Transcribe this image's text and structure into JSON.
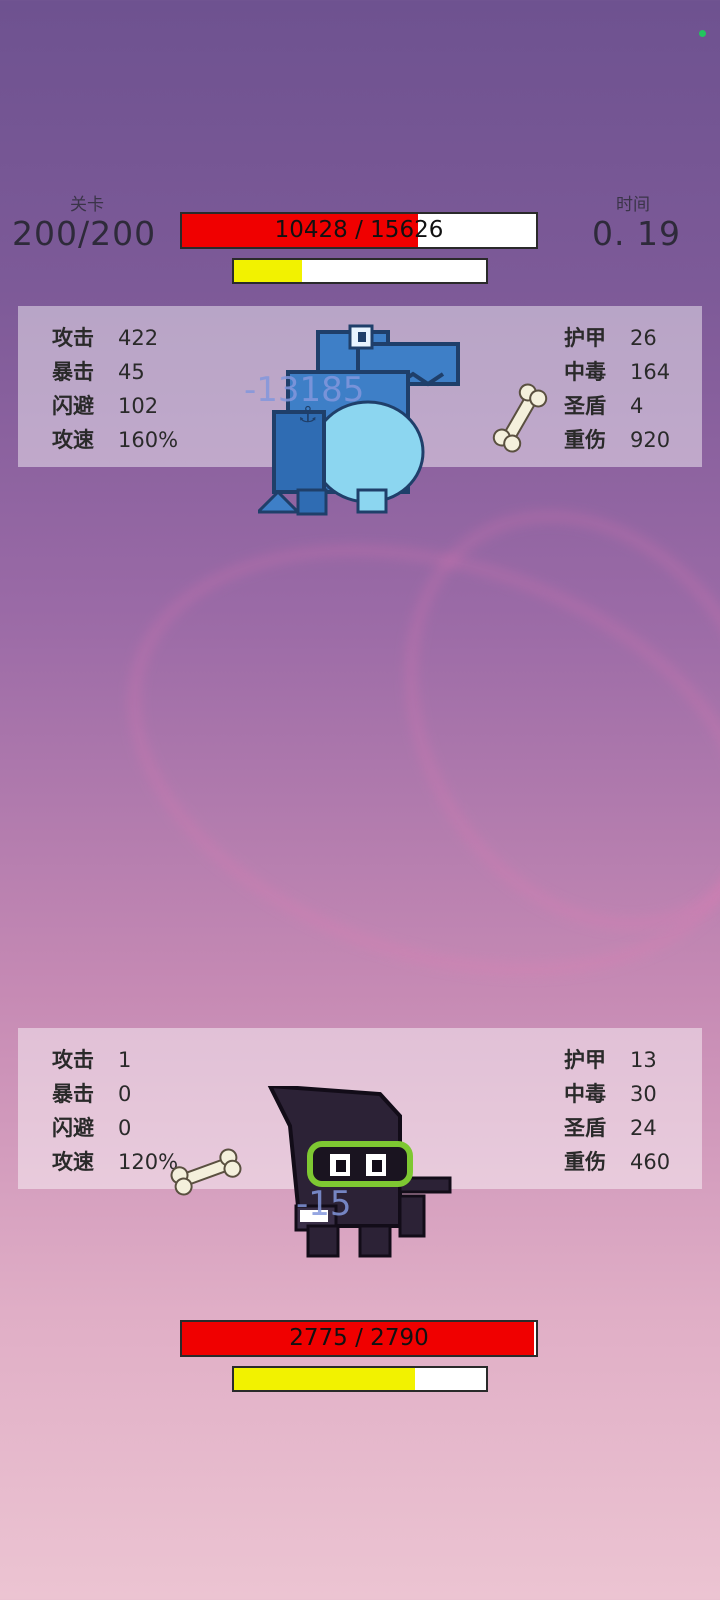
{
  "header": {
    "level_label": "关卡",
    "level_value": "200/200",
    "time_label": "时间",
    "time_value": "0. 19"
  },
  "enemy": {
    "hp_text": "10428 / 15626",
    "hp_fraction": 0.667,
    "energy_fraction": 0.27,
    "damage_text": "-13185",
    "stats_left": [
      {
        "label": "攻击",
        "value": "422"
      },
      {
        "label": "暴击",
        "value": "45"
      },
      {
        "label": "闪避",
        "value": "102"
      },
      {
        "label": "攻速",
        "value": "160%"
      }
    ],
    "stats_right": [
      {
        "label": "护甲",
        "value": "26"
      },
      {
        "label": "中毒",
        "value": "164"
      },
      {
        "label": "圣盾",
        "value": "4"
      },
      {
        "label": "重伤",
        "value": "920"
      }
    ]
  },
  "player": {
    "hp_text": "2775 / 2790",
    "hp_fraction": 0.995,
    "energy_fraction": 0.72,
    "damage_text": "-15",
    "stats_left": [
      {
        "label": "攻击",
        "value": "1"
      },
      {
        "label": "暴击",
        "value": "0"
      },
      {
        "label": "闪避",
        "value": "0"
      },
      {
        "label": "攻速",
        "value": "120%"
      }
    ],
    "stats_right": [
      {
        "label": "护甲",
        "value": "13"
      },
      {
        "label": "中毒",
        "value": "30"
      },
      {
        "label": "圣盾",
        "value": "24"
      },
      {
        "label": "重伤",
        "value": "460"
      }
    ]
  },
  "colors": {
    "hp": "#f00000",
    "energy": "#f2f200",
    "status_dot": "#22c55e"
  },
  "icons": {
    "enemy_sprite": "blue-crocodile-sprite",
    "player_sprite": "hooded-ninja-sprite",
    "projectile": "bone-icon"
  }
}
